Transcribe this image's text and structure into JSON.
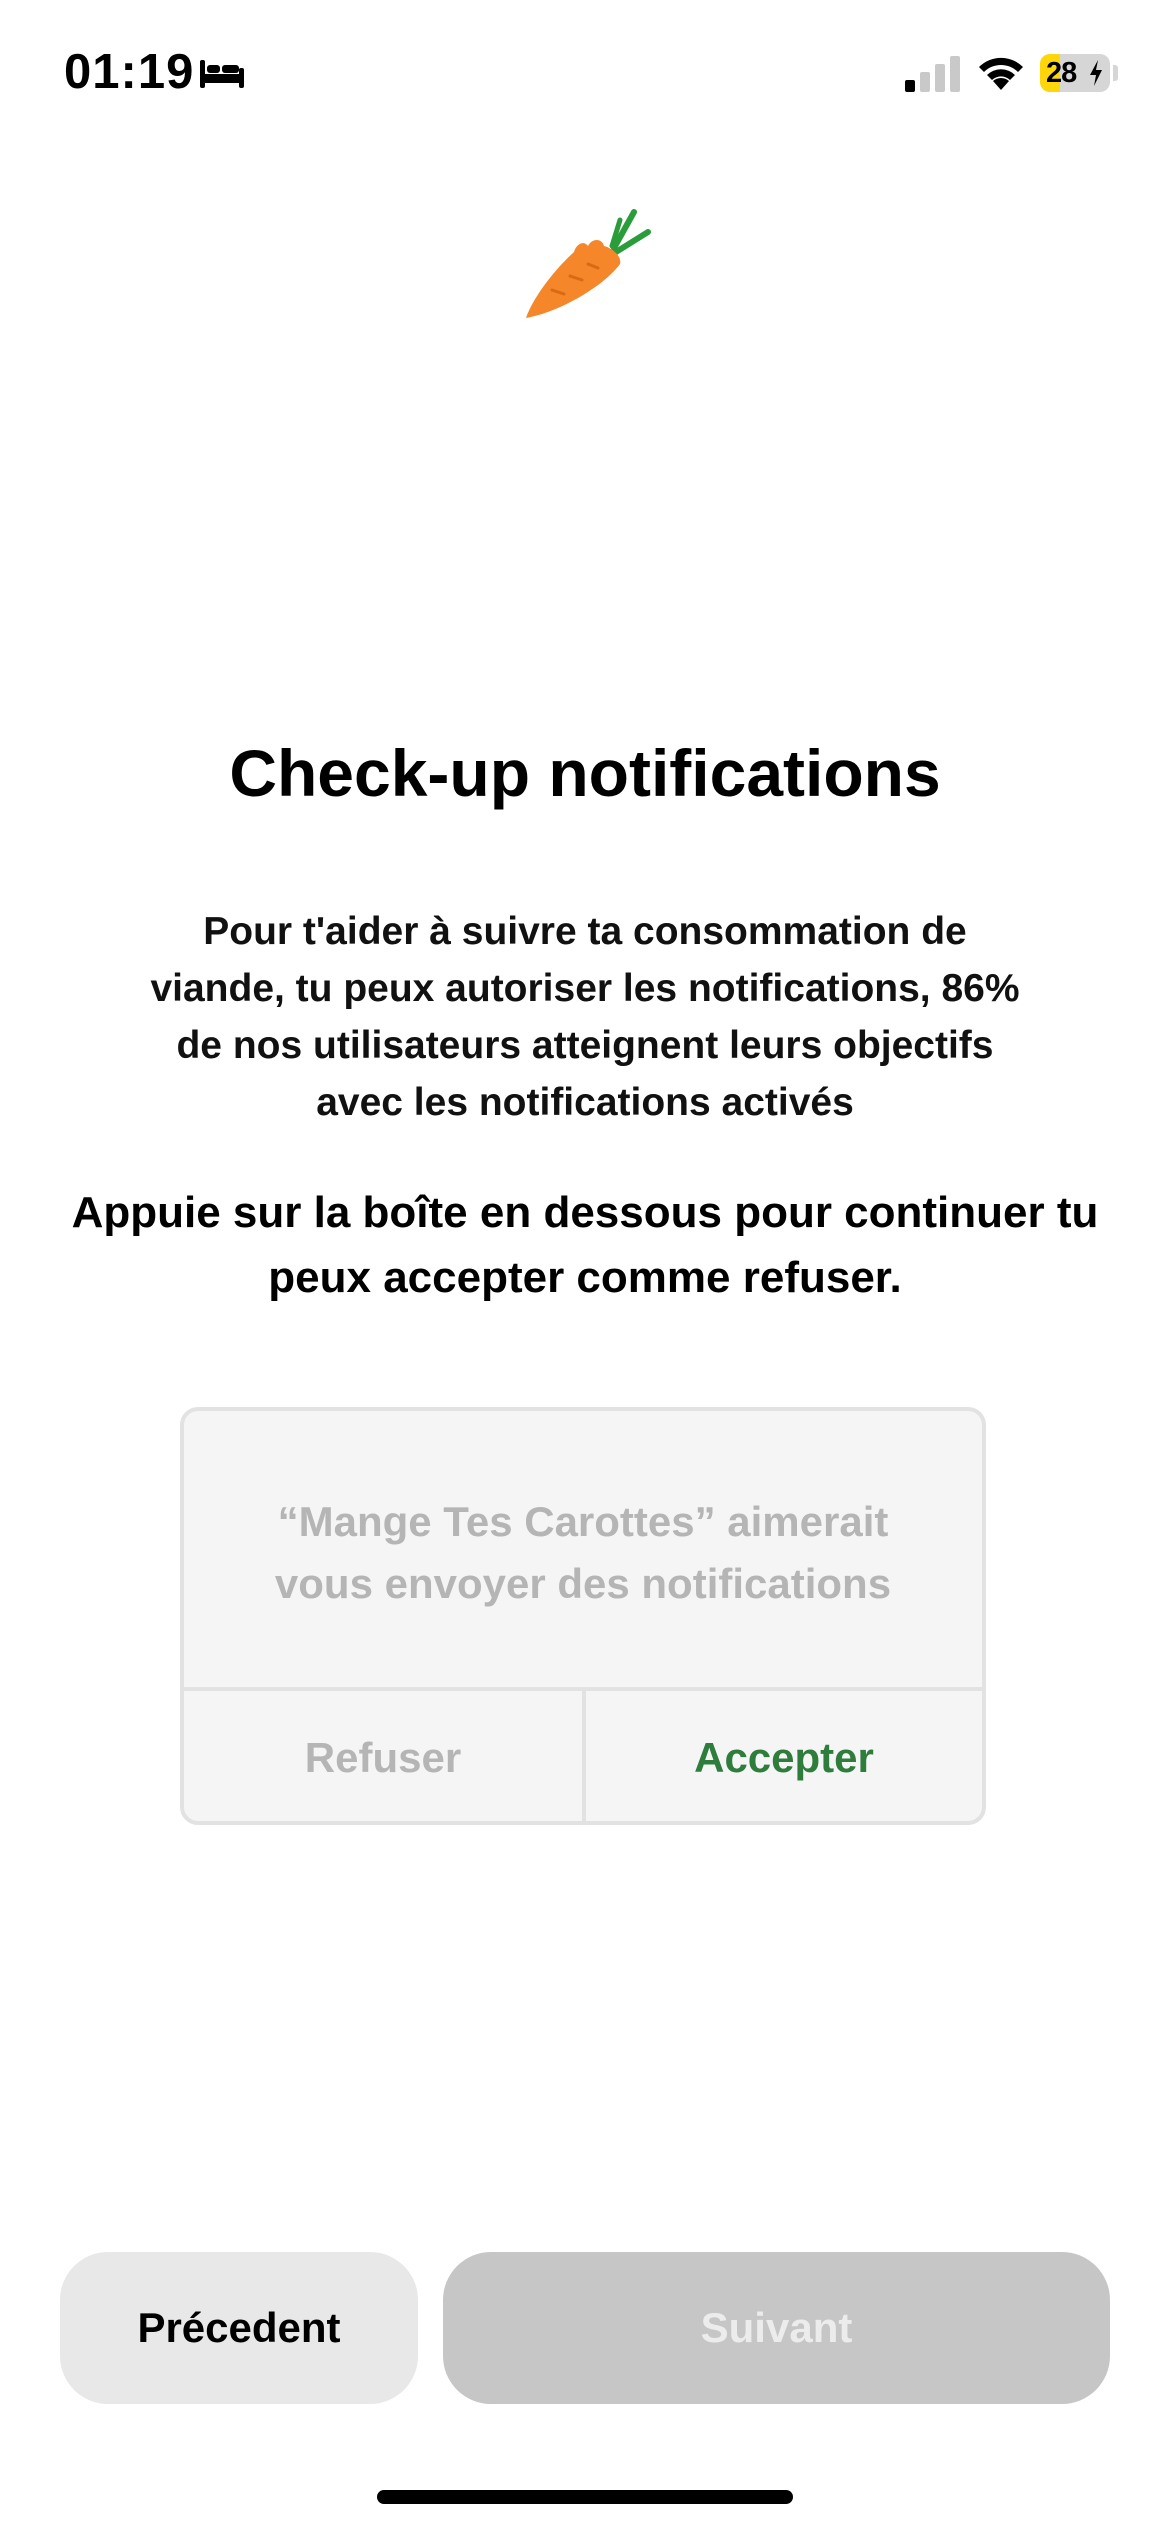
{
  "status_bar": {
    "time": "01:19",
    "battery_level": "28",
    "battery_fraction": 0.28,
    "sleep_focus_icon": "bed-icon",
    "signal_bars_active": 1,
    "signal_bars_total": 4,
    "charging": true
  },
  "logo": {
    "icon": "carrot-icon"
  },
  "content": {
    "title": "Check-up notifications",
    "description": "Pour t'aider à suivre ta consommation de viande, tu peux autoriser les notifications, 86% de nos utilisateurs atteignent leurs objectifs avec les notifications activés",
    "instruction": "Appuie sur la boîte en dessous pour continuer tu peux accepter comme refuser."
  },
  "alert": {
    "message_line1": "“Mange Tes Carottes” aimerait",
    "message_line2": "vous envoyer des notifications",
    "refuse_label": "Refuser",
    "accept_label": "Accepter"
  },
  "navigation": {
    "previous_label": "Précedent",
    "next_label": "Suivant",
    "next_enabled": false
  },
  "colors": {
    "accept_green": "#2e7d3c",
    "carrot_orange": "#f5862a",
    "carrot_leaf": "#2a9d3a",
    "battery_yellow": "#ffd60a",
    "next_disabled_bg": "#c6c6c6",
    "previous_bg": "#e8e8e8"
  }
}
